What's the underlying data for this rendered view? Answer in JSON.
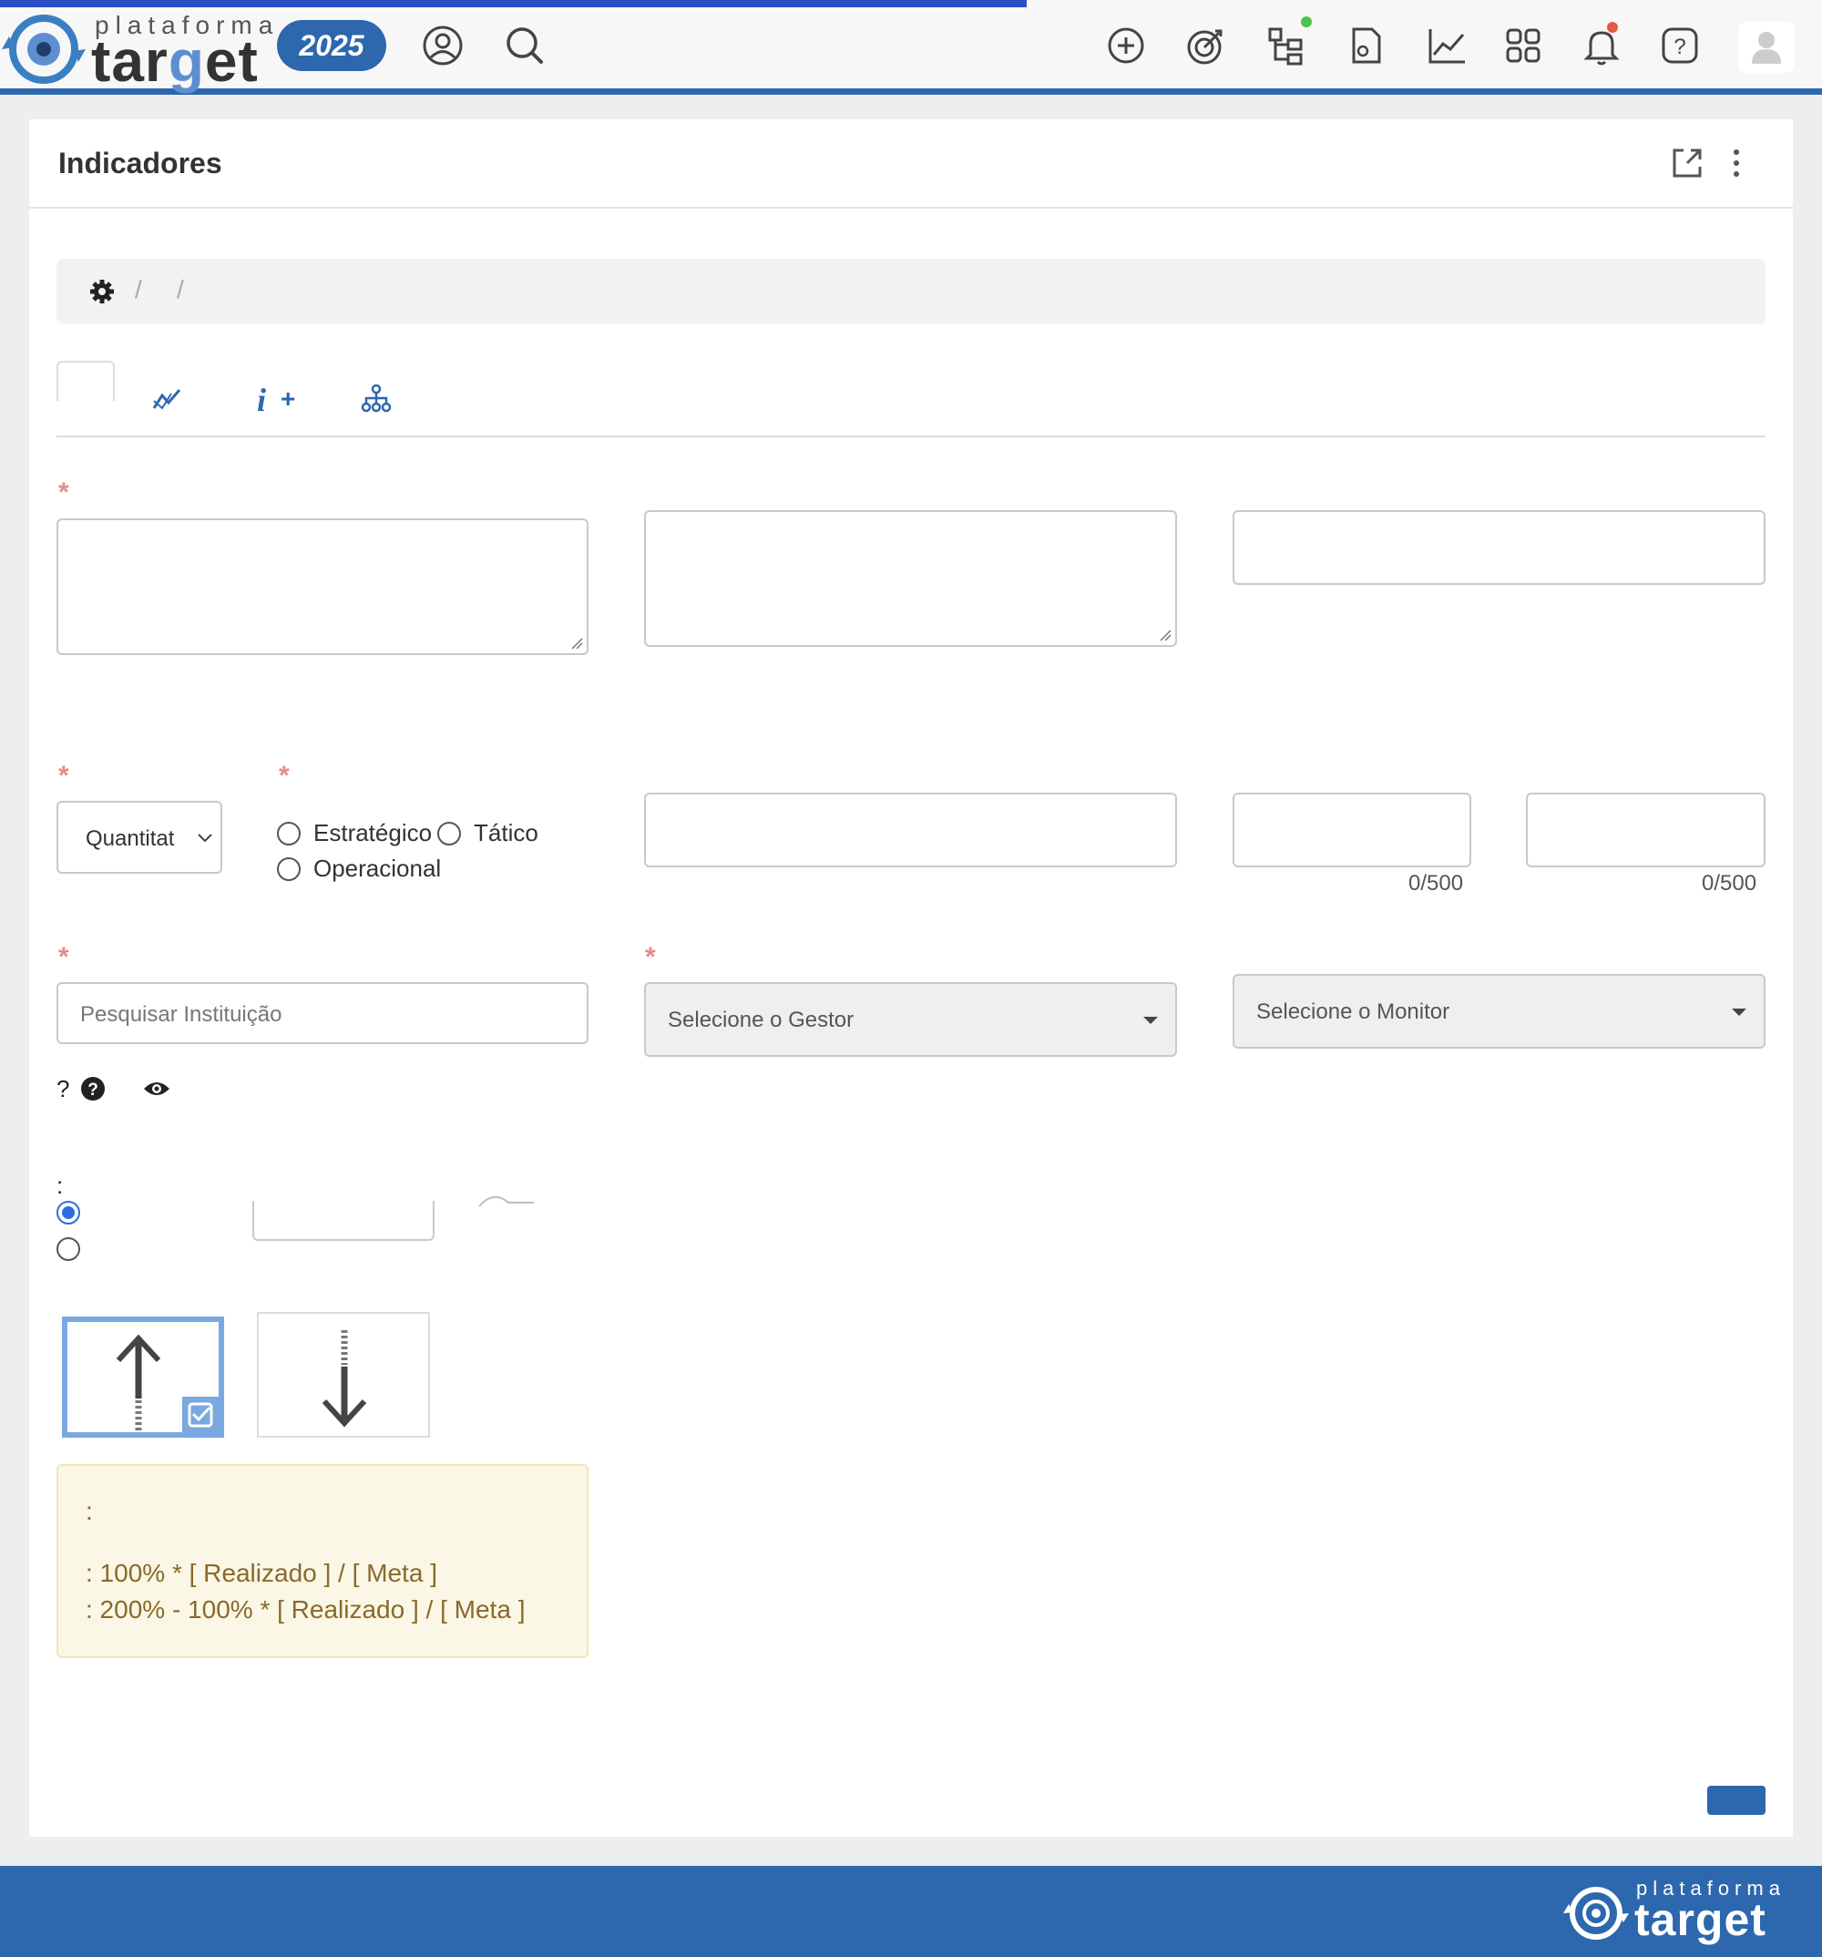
{
  "brand": {
    "small": "plataforma",
    "big": "target",
    "year": "2025"
  },
  "colors": {
    "primary": "#2d67ae",
    "progress": "#2b4fc4",
    "required": "#e88a8a",
    "info_bg": "#faf7e6",
    "info_text": "#8a6a2a"
  },
  "topbar": {
    "icons": [
      "profile-icon",
      "search-icon",
      "add-circle-icon",
      "target-icon",
      "hierarchy-icon",
      "document-settings-icon",
      "chart-line-icon",
      "apps-grid-icon",
      "bell-icon",
      "help-icon",
      "user-avatar-icon"
    ]
  },
  "card": {
    "title": "Indicadores",
    "breadcrumb": {
      "sep1": "/",
      "sep2": "/"
    }
  },
  "tabs": {
    "info_plus": "+"
  },
  "form": {
    "required_mark": "*",
    "type_select_value": "Quantitat",
    "levels": {
      "strategic": "Estratégico",
      "tactical": "Tático",
      "operational": "Operacional"
    },
    "counter1": "0/500",
    "counter2": "0/500",
    "institution_placeholder": "Pesquisar Instituição",
    "manager_placeholder": "Selecione o Gestor",
    "monitor_placeholder": "Selecione o Monitor",
    "help_q": "?",
    "colon_label": ":"
  },
  "info": {
    "line1": ":",
    "line2": ": 100% * [ Realizado ] / [ Meta ]",
    "line3": ": 200% - 100% * [ Realizado ] / [ Meta ]"
  },
  "footer": {
    "small": "plataforma",
    "big": "target"
  }
}
